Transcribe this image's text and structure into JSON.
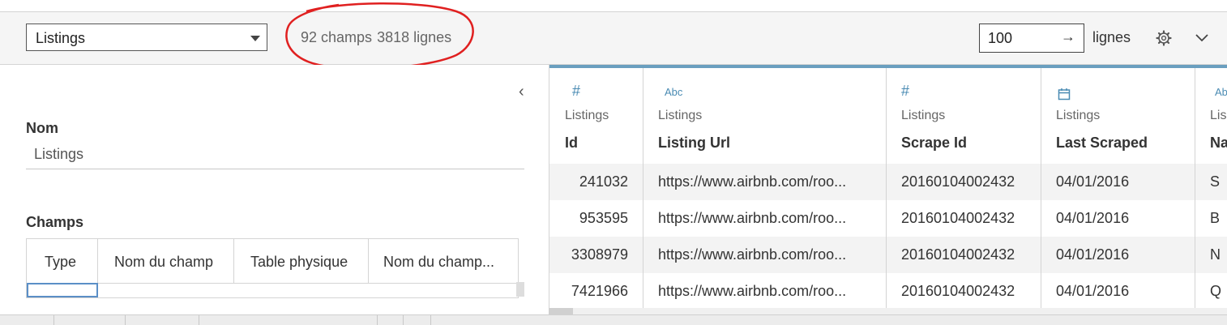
{
  "toolbar": {
    "source_value": "Listings",
    "fields_count": "92 champs",
    "rows_count": "3818 lignes",
    "rows_limit": "100",
    "rows_arrow": "→",
    "rows_label": "lignes"
  },
  "left_panel": {
    "collapse_glyph": "‹",
    "name_label": "Nom",
    "name_value": "Listings",
    "fields_label": "Champs",
    "fields_headers": [
      "Type",
      "Nom du champ",
      "Table physique",
      "Nom du champ..."
    ]
  },
  "grid": {
    "columns": [
      {
        "type_icon": "#",
        "source": "Listings",
        "name": "Id"
      },
      {
        "type_icon": "Abc",
        "source": "Listings",
        "name": "Listing Url"
      },
      {
        "type_icon": "#",
        "source": "Listings",
        "name": "Scrape Id"
      },
      {
        "type_icon": "date-icon",
        "source": "Listings",
        "name": "Last Scraped"
      },
      {
        "type_icon": "Ab",
        "source": "Lis",
        "name": "Na"
      }
    ],
    "rows": [
      [
        "241032",
        "https://www.airbnb.com/roo...",
        "20160104002432",
        "04/01/2016",
        "S"
      ],
      [
        "953595",
        "https://www.airbnb.com/roo...",
        "20160104002432",
        "04/01/2016",
        "B"
      ],
      [
        "3308979",
        "https://www.airbnb.com/roo...",
        "20160104002432",
        "04/01/2016",
        "N"
      ],
      [
        "7421966",
        "https://www.airbnb.com/roo...",
        "20160104002432",
        "04/01/2016",
        "Q"
      ]
    ]
  },
  "colors": {
    "annotation": "#e02020",
    "accent": "#4a8bb3"
  }
}
